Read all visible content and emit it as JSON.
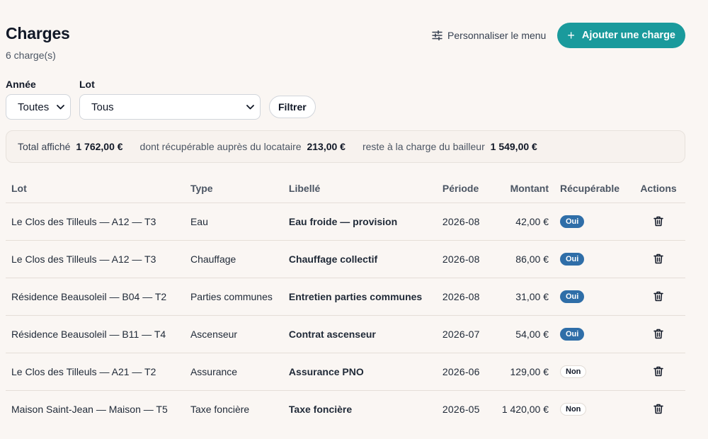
{
  "header": {
    "title": "Charges",
    "subtitle": "6 charge(s)",
    "customize_label": "Personnaliser le menu",
    "add_label": "Ajouter une charge",
    "accent_color": "#1a9a9c"
  },
  "filters": {
    "year_label": "Année",
    "year_value": "Toutes",
    "lot_label": "Lot",
    "lot_value": "Tous",
    "filter_button": "Filtrer"
  },
  "totals": {
    "displayed_label": "Total affiché",
    "displayed_value": "1 762,00 €",
    "recoverable_label": "dont récupérable auprès du locataire",
    "recoverable_value": "213,00 €",
    "landlord_label": "reste à la charge du bailleur",
    "landlord_value": "1 549,00 €"
  },
  "table": {
    "columns": [
      "Lot",
      "Type",
      "Libellé",
      "Période",
      "Montant",
      "Récupérable",
      "Actions"
    ],
    "rows": [
      {
        "lot": "Le Clos des Tilleuls — A12 — T3",
        "type": "Eau",
        "label": "Eau froide — provision",
        "period": "2026-08",
        "amount": "42,00 €",
        "recoverable": "Oui"
      },
      {
        "lot": "Le Clos des Tilleuls — A12 — T3",
        "type": "Chauffage",
        "label": "Chauffage collectif",
        "period": "2026-08",
        "amount": "86,00 €",
        "recoverable": "Oui"
      },
      {
        "lot": "Résidence Beausoleil — B04 — T2",
        "type": "Parties communes",
        "label": "Entretien parties communes",
        "period": "2026-08",
        "amount": "31,00 €",
        "recoverable": "Oui"
      },
      {
        "lot": "Résidence Beausoleil — B11 — T4",
        "type": "Ascenseur",
        "label": "Contrat ascenseur",
        "period": "2026-07",
        "amount": "54,00 €",
        "recoverable": "Oui"
      },
      {
        "lot": "Le Clos des Tilleuls — A21 — T2",
        "type": "Assurance",
        "label": "Assurance PNO",
        "period": "2026-06",
        "amount": "129,00 €",
        "recoverable": "Non"
      },
      {
        "lot": "Maison Saint-Jean — Maison — T5",
        "type": "Taxe foncière",
        "label": "Taxe foncière",
        "period": "2026-05",
        "amount": "1 420,00 €",
        "recoverable": "Non"
      }
    ]
  },
  "icons": {
    "customize": "sliders-icon",
    "add": "plus-icon",
    "delete": "trash-icon",
    "select": "chevron-down-icon"
  }
}
